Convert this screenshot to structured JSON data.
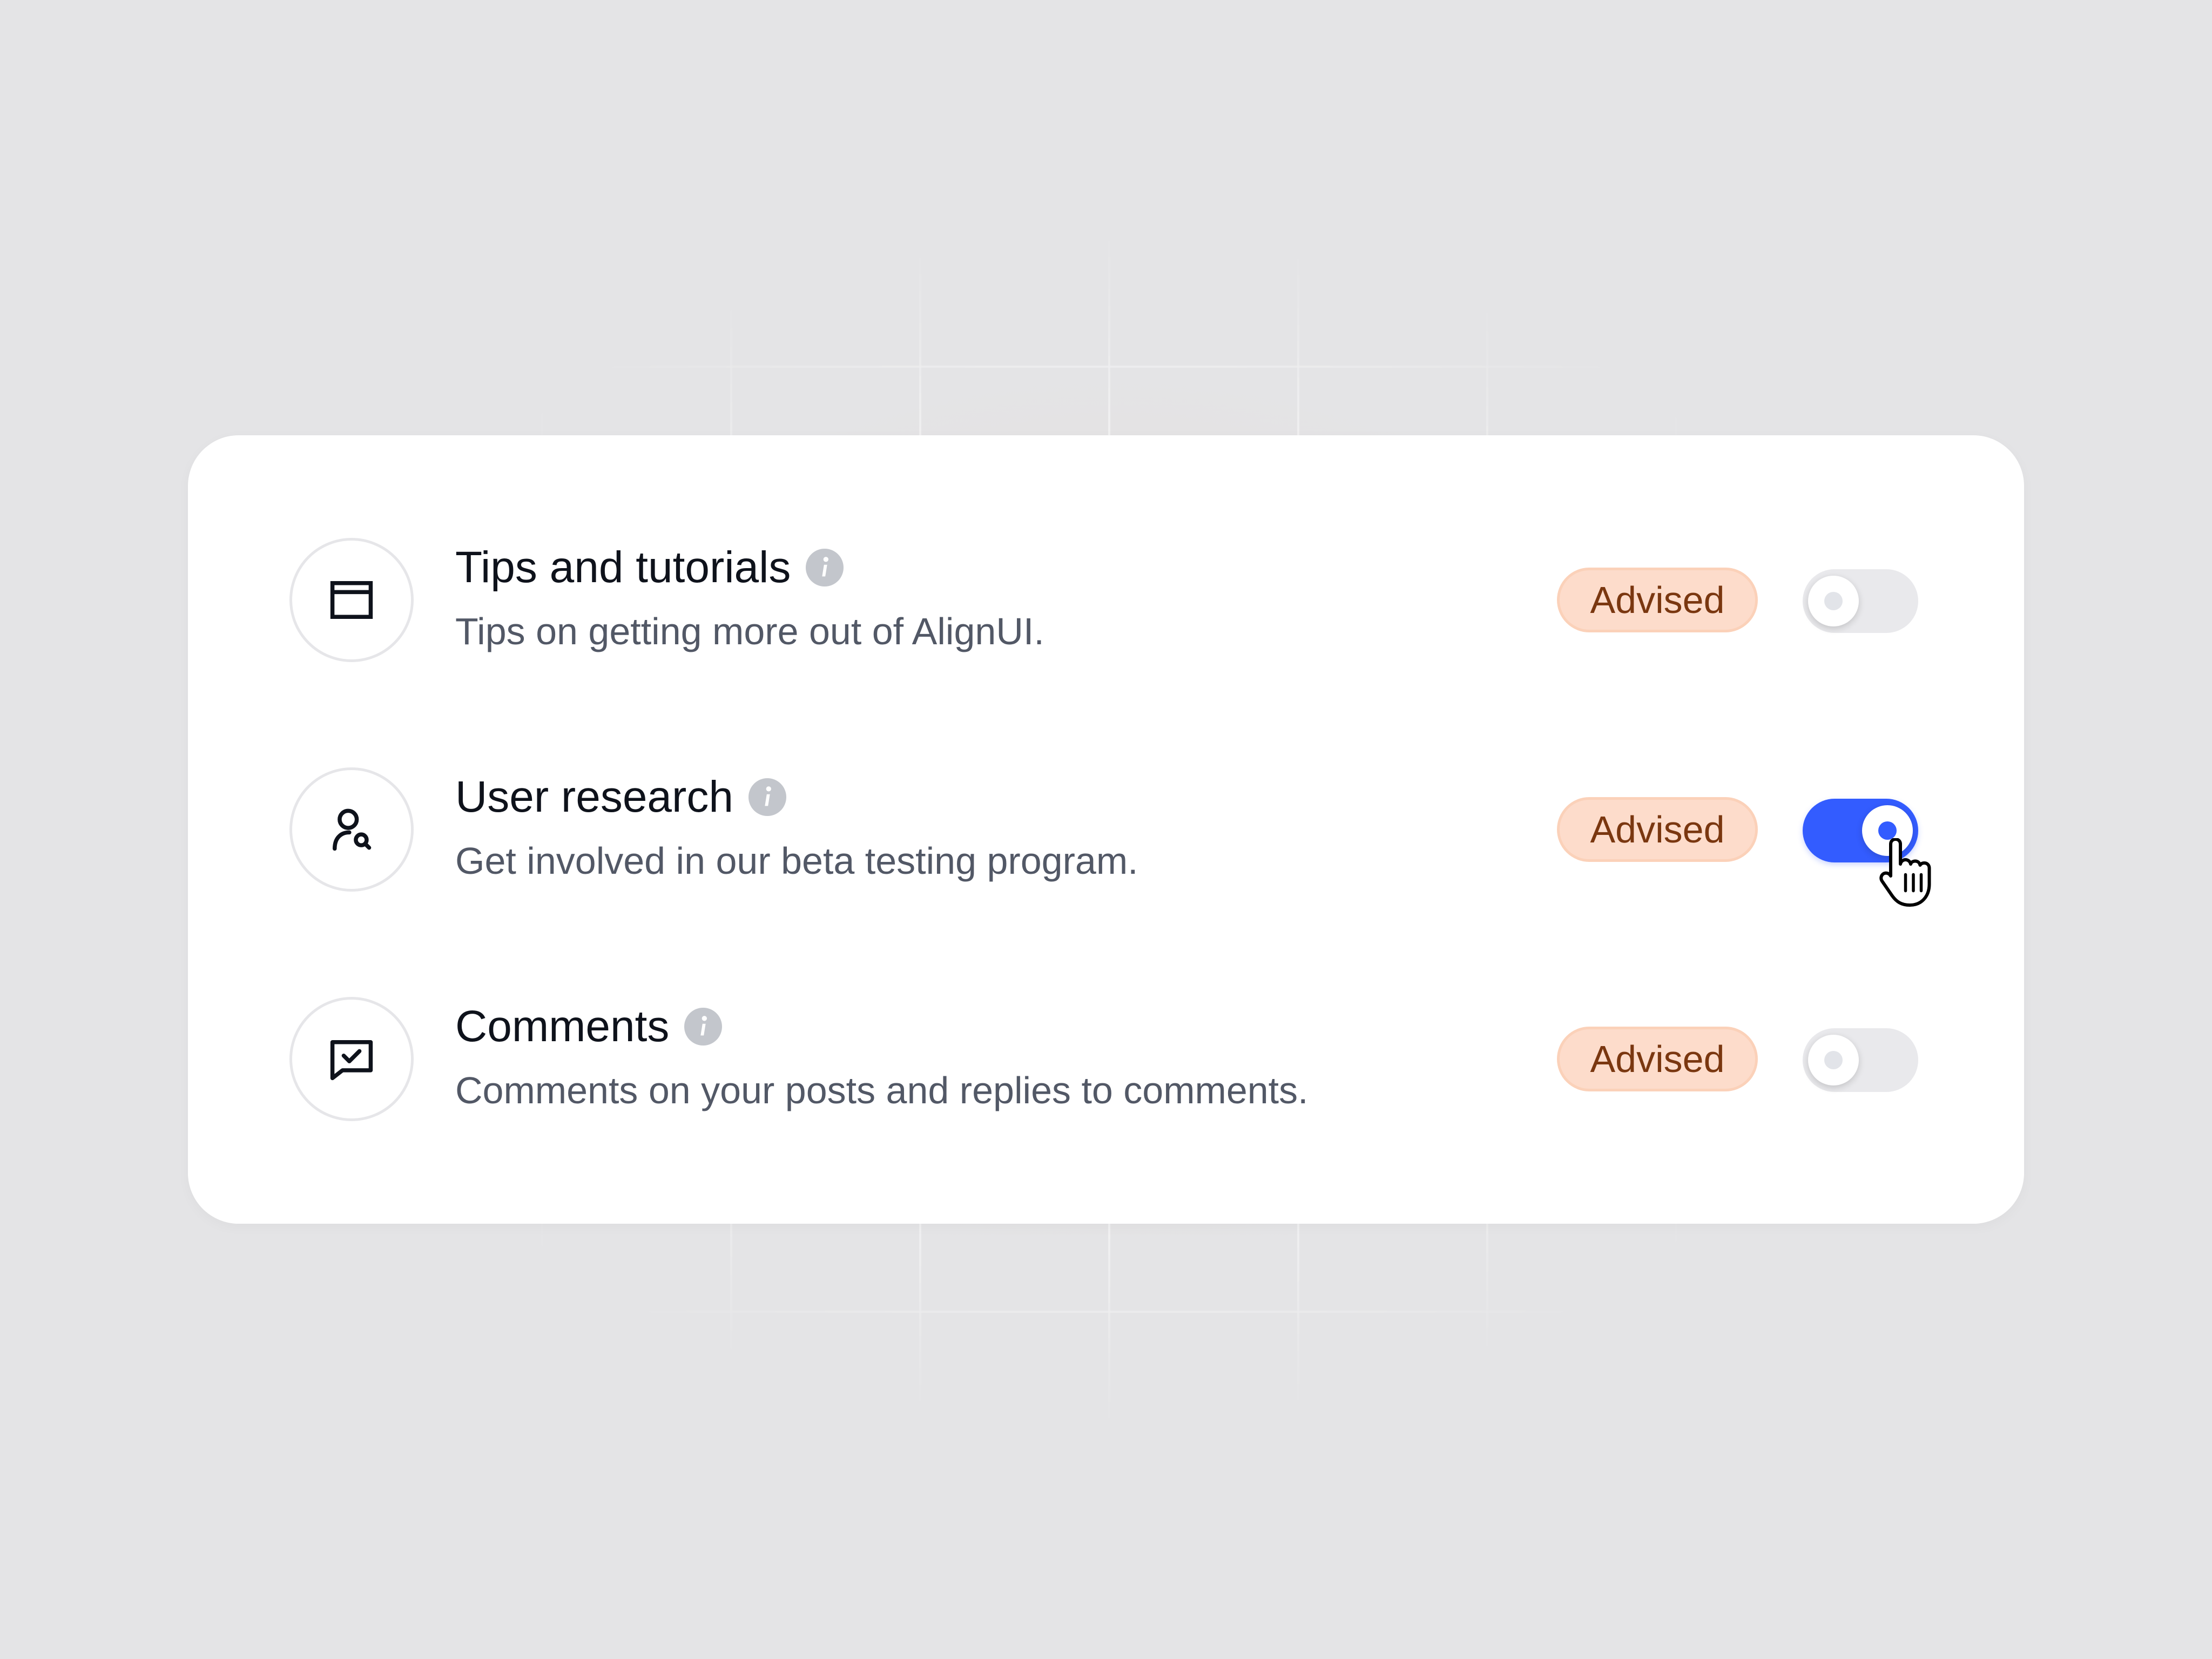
{
  "settings": {
    "items": [
      {
        "icon": "window-icon",
        "title": "Tips and tutorials",
        "description": "Tips on getting more out of AlignUI.",
        "badge": "Advised",
        "enabled": false
      },
      {
        "icon": "user-search-icon",
        "title": "User research",
        "description": "Get involved in our beta testing program.",
        "badge": "Advised",
        "enabled": true
      },
      {
        "icon": "chat-check-icon",
        "title": "Comments",
        "description": "Comments on your posts and replies to comments.",
        "badge": "Advised",
        "enabled": false
      }
    ]
  },
  "colors": {
    "accent": "#335cff",
    "badge_bg": "#fddccb",
    "badge_text": "#7a3710",
    "toggle_off": "#e9e9ec"
  }
}
